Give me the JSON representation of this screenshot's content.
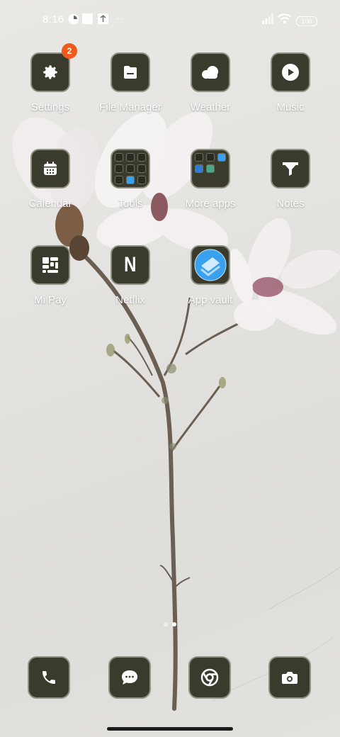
{
  "status_bar": {
    "time": "8:16",
    "battery": "100",
    "more_indicator": "··"
  },
  "apps": [
    {
      "label": "Settings",
      "icon": "gear-icon",
      "badge": "2"
    },
    {
      "label": "File Manager",
      "icon": "folder-icon"
    },
    {
      "label": "Weather",
      "icon": "cloud-icon"
    },
    {
      "label": "Music",
      "icon": "play-icon"
    },
    {
      "label": "Calendar",
      "icon": "calendar-icon"
    },
    {
      "label": "Tools",
      "icon": "folder-grid-icon"
    },
    {
      "label": "More apps",
      "icon": "folder-grid-icon"
    },
    {
      "label": "Notes",
      "icon": "funnel-icon"
    },
    {
      "label": "Mi Pay",
      "icon": "mi-pay-icon"
    },
    {
      "label": "Netflix",
      "icon": "netflix-icon",
      "glyph": "N"
    },
    {
      "label": "App vault",
      "icon": "app-vault-icon"
    }
  ],
  "dock": [
    {
      "icon": "phone-icon"
    },
    {
      "icon": "message-icon"
    },
    {
      "icon": "chrome-icon"
    },
    {
      "icon": "camera-icon"
    }
  ],
  "page_indicator": {
    "pages": 2,
    "active": 2
  },
  "colors": {
    "tile_bg": "#3a3b2c",
    "tile_border": "#8e9184",
    "badge": "#ef5a1d",
    "vault_blue": "#3aa0f0"
  }
}
